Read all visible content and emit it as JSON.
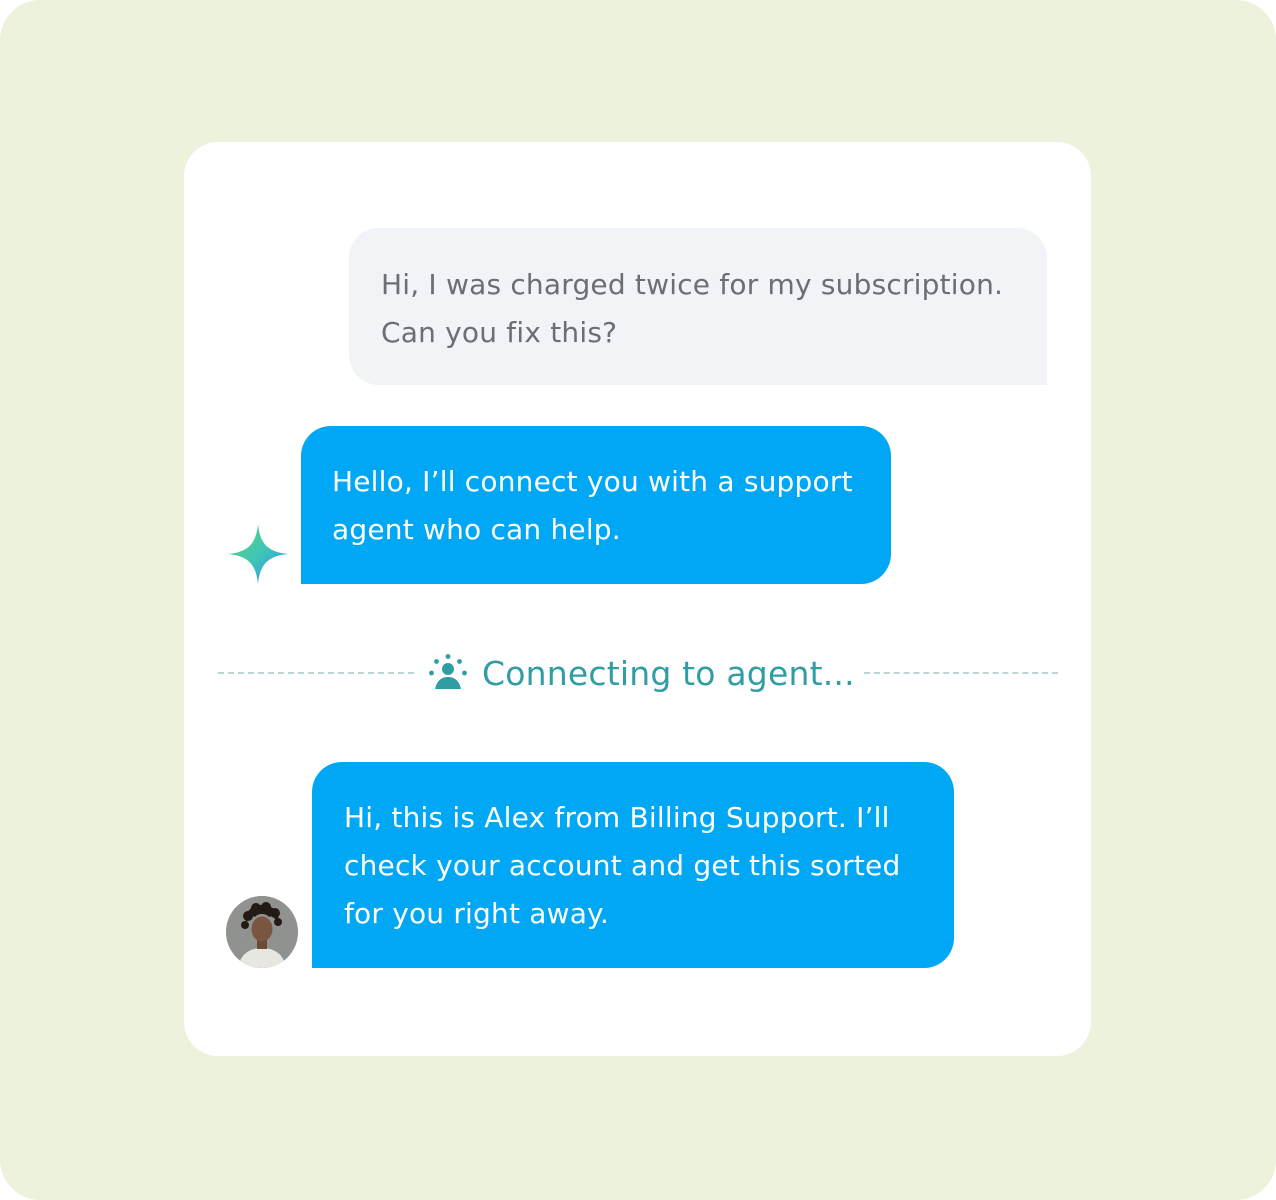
{
  "conversation": {
    "messages": [
      {
        "sender": "user",
        "lines": [
          "Hi, I was charged twice for my subscription.",
          "Can you fix this?"
        ]
      },
      {
        "sender": "ai-assistant",
        "icon": "sparkle-icon",
        "lines": [
          "Hello, I’ll connect you with a support",
          "agent who can help."
        ]
      },
      {
        "sender": "human-agent",
        "icon": "agent-avatar",
        "lines": [
          "Hi, this is Alex from Billing Support. I’ll",
          "check your account and get this sorted",
          "for you right away."
        ]
      }
    ],
    "status": {
      "icon": "agent-connecting-icon",
      "text": "Connecting to agent..."
    }
  },
  "colors": {
    "background": "#ecf2dc",
    "card": "#ffffff",
    "user_bubble": "#f1f3f6",
    "user_text": "#6b6e74",
    "agent_bubble": "#00a7f5",
    "agent_text": "#ffffff",
    "status_text": "#2f9ea4",
    "divider": "#b9d6d6"
  }
}
